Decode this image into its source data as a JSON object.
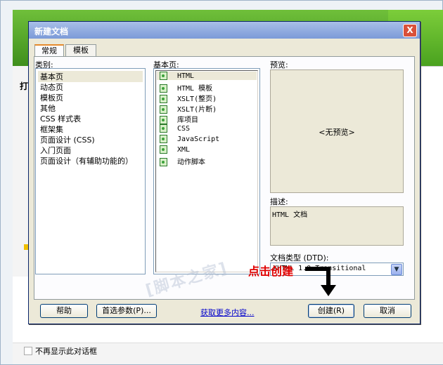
{
  "background": {
    "checkbox_label": "不再显示此对话框",
    "left_glyph": "打"
  },
  "dialog": {
    "title": "新建文档",
    "close_glyph": "X",
    "tabs": [
      {
        "label": "常规",
        "active": true
      },
      {
        "label": "模板",
        "active": false
      }
    ],
    "category": {
      "label": "类别:",
      "items": [
        "基本页",
        "动态页",
        "模板页",
        "其他",
        "CSS 样式表",
        "框架集",
        "页面设计 (CSS)",
        "入门页面",
        "页面设计（有辅助功能的）"
      ],
      "selected_index": 0
    },
    "basic_page": {
      "label": "基本页:",
      "items": [
        "HTML",
        "HTML 模板",
        "XSLT(整页)",
        "XSLT(片断)",
        "库项目",
        "CSS",
        "JavaScript",
        "XML",
        "动作脚本"
      ],
      "selected_index": 0
    },
    "preview": {
      "label": "预览:",
      "text": "<无预览>"
    },
    "description": {
      "label": "描述:",
      "text": "HTML 文档"
    },
    "doctype": {
      "label": "文档类型 (DTD):",
      "value": "XHTML 1.0 Transitional"
    },
    "buttons": {
      "help": "帮助",
      "preferences": "首选参数(P)...",
      "more_content": "获取更多内容...",
      "create": "创建(R)",
      "cancel": "取消"
    }
  },
  "annotation": {
    "text": "点击创建",
    "color": "#e00000"
  },
  "watermark": "[脚本之家]"
}
